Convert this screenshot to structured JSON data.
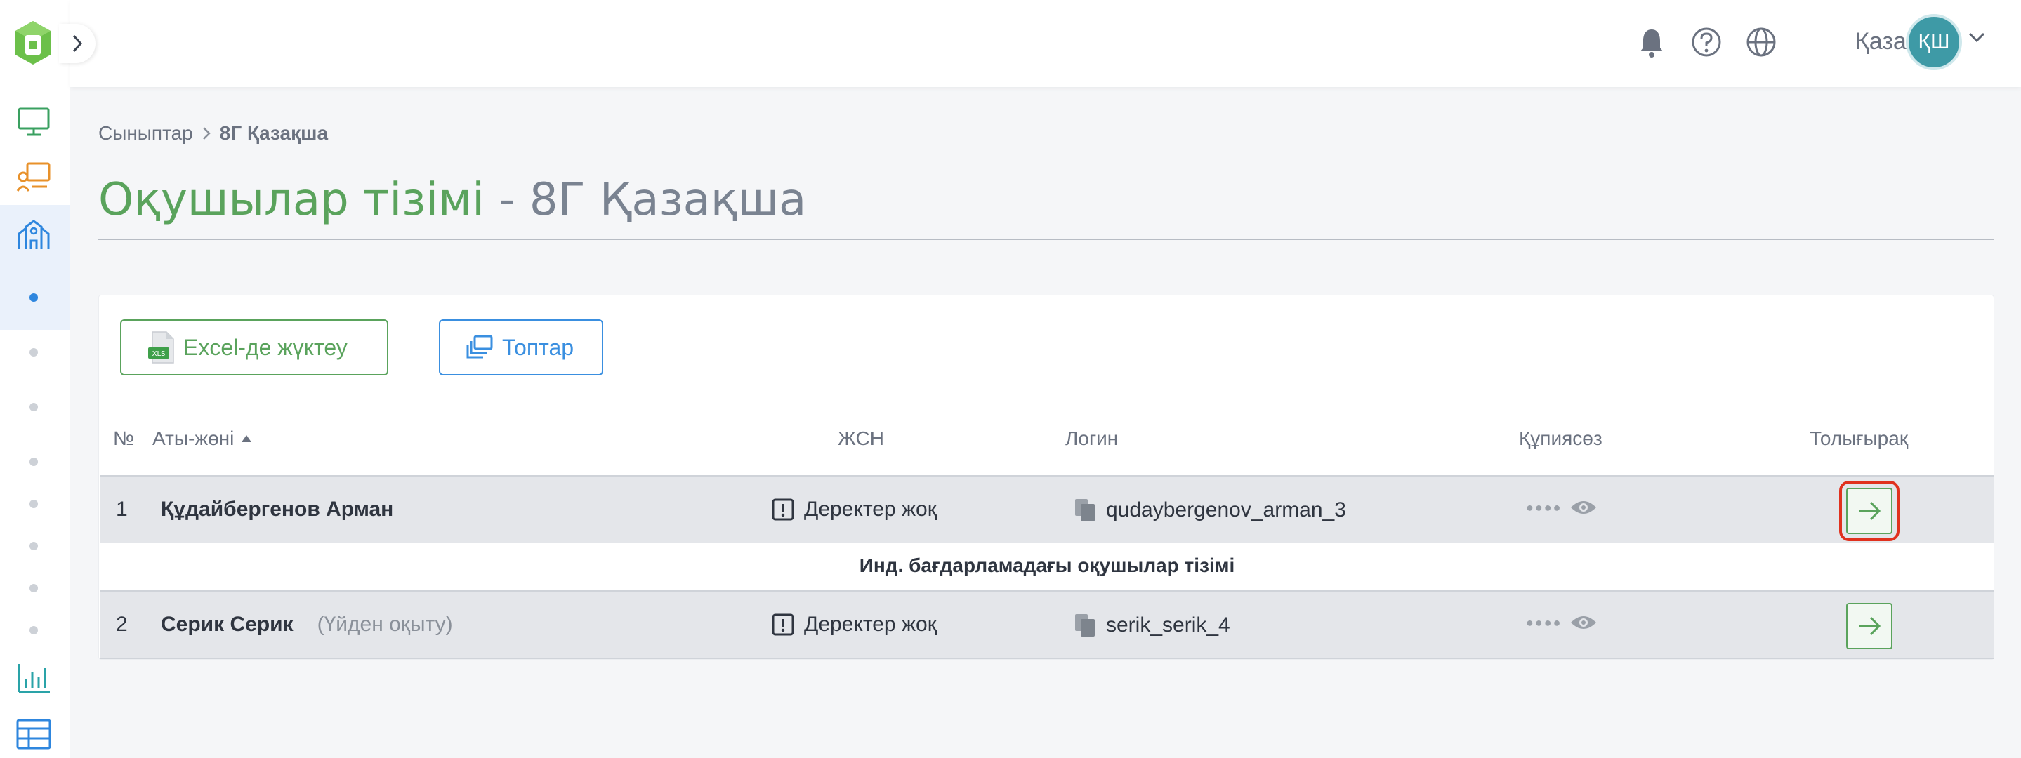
{
  "header": {
    "language": "Қазақша",
    "avatar_initials": "ҚШ"
  },
  "breadcrumb": {
    "root": "Сыныптар",
    "current": "8Г Қазақша"
  },
  "page_title": {
    "main": "Оқушылар тізімі",
    "separator": " - ",
    "class_name": "8Г Қазақша"
  },
  "toolbar": {
    "excel_label": "Excel-де жүктеу",
    "excel_icon_text": "XLS",
    "groups_label": "Топтар"
  },
  "table": {
    "columns": {
      "num": "№",
      "name": "Аты-жөні",
      "jsn": "ЖСН",
      "login": "Логин",
      "password": "Құпиясөз",
      "details": "Толығырақ"
    },
    "rows": [
      {
        "num": "1",
        "name": "Құдайбергенов Арман",
        "note": "",
        "jsn": "Деректер жоқ",
        "login": "qudaybergenov_arman_3",
        "password_mask": "●●●●"
      },
      {
        "num": "2",
        "name": "Серик Серик",
        "note": "(Үйден оқыту)",
        "jsn": "Деректер жоқ",
        "login": "serik_serik_4",
        "password_mask": "●●●●"
      }
    ],
    "section_title": "Инд. бағдарламадағы оқушылар тізімі"
  },
  "colors": {
    "brand_green": "#5aa35c",
    "accent_blue": "#3a8fe0",
    "highlight_red": "#e0311e"
  }
}
